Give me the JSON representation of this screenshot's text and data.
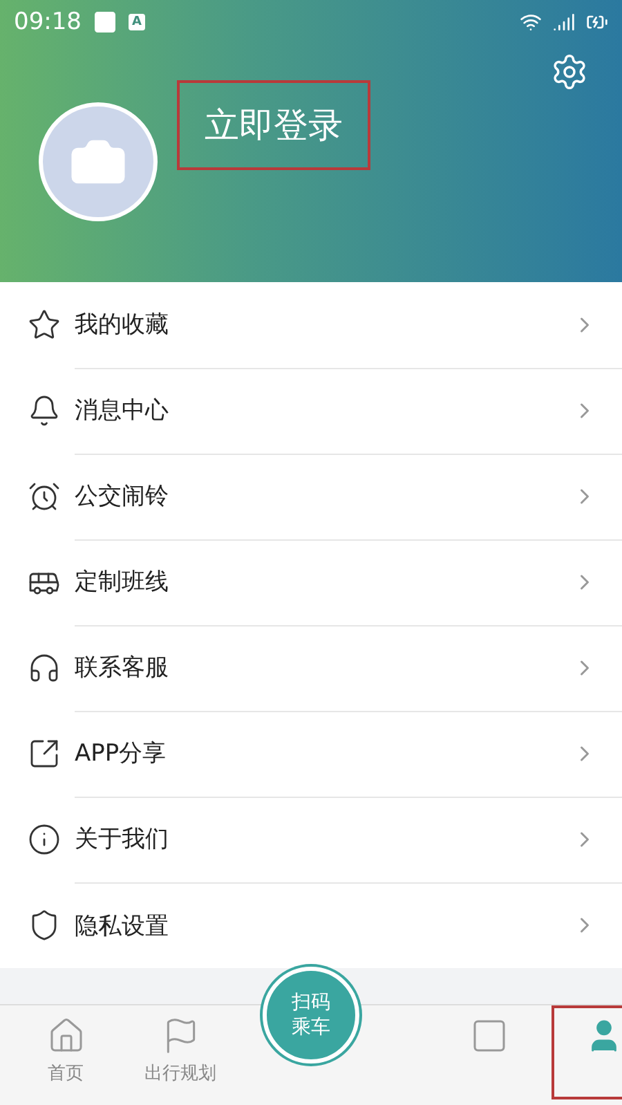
{
  "status_bar": {
    "time": "09:18",
    "notification_badge": "A"
  },
  "profile": {
    "login_label": "立即登录",
    "highlighted": true
  },
  "menu": [
    {
      "kind": "star",
      "label": "我的收藏"
    },
    {
      "kind": "bell",
      "label": "消息中心"
    },
    {
      "kind": "alarm",
      "label": "公交闹铃"
    },
    {
      "kind": "bus",
      "label": "定制班线"
    },
    {
      "kind": "headset",
      "label": "联系客服"
    },
    {
      "kind": "share",
      "label": "APP分享"
    },
    {
      "kind": "info",
      "label": "关于我们"
    },
    {
      "kind": "privacy",
      "label": "隐私设置"
    }
  ],
  "tab_bar": {
    "tabs": [
      {
        "kind": "home",
        "label": "首页",
        "selected": false,
        "highlighted": false
      },
      {
        "kind": "route",
        "label": "出行规划",
        "selected": false,
        "highlighted": false
      },
      {
        "kind": "card",
        "selected": false,
        "highlighted": false
      },
      {
        "kind": "profile",
        "selected": true,
        "highlighted": true
      }
    ],
    "scan_button": {
      "line_1": "扫码",
      "line_2": "乘车"
    }
  }
}
